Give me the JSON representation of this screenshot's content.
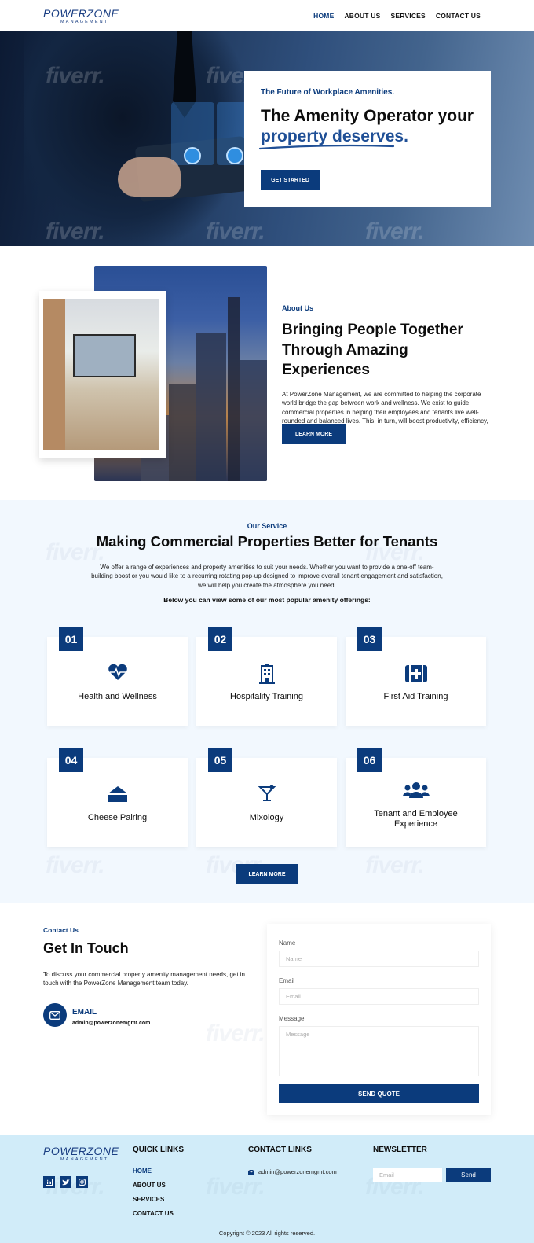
{
  "header": {
    "logo_main": "POWERZONE",
    "logo_sub": "MANAGEMENT",
    "nav": [
      {
        "label": "HOME",
        "active": true
      },
      {
        "label": "ABOUT US",
        "active": false
      },
      {
        "label": "SERVICES",
        "active": false
      },
      {
        "label": "CONTACT US",
        "active": false
      }
    ]
  },
  "hero": {
    "pretitle": "The Future of Workplace Amenities.",
    "title_line1": "The Amenity Operator your",
    "title_line2": "property deserves.",
    "cta": "GET STARTED"
  },
  "about": {
    "pretitle": "About Us",
    "title": "Bringing People Together Through Amazing Experiences",
    "body": "At PowerZone Management, we are committed to helping the corporate world bridge the gap between work and wellness. We exist to guide commercial properties in helping their employees and tenants live well-rounded and balanced lives. This, in turn, will boost productivity, efficiency, and satisfaction.",
    "cta": "LEARN MORE"
  },
  "services": {
    "pretitle": "Our Service",
    "title": "Making Commercial Properties Better for Tenants",
    "body": "We offer a range of experiences and property amenities to suit your needs. Whether you want to provide a one-off team-building boost or you would like to a recurring rotating pop-up designed to improve overall tenant engagement and satisfaction, we will help you create the atmosphere you need.",
    "subheading": "Below you can view some of our most popular amenity offerings:",
    "cards": [
      {
        "num": "01",
        "label": "Health and Wellness",
        "icon": "heartbeat-icon"
      },
      {
        "num": "02",
        "label": "Hospitality Training",
        "icon": "hotel-icon"
      },
      {
        "num": "03",
        "label": "First Aid Training",
        "icon": "first-aid-icon"
      },
      {
        "num": "04",
        "label": "Cheese Pairing",
        "icon": "cheese-icon"
      },
      {
        "num": "05",
        "label": "Mixology",
        "icon": "cocktail-icon"
      },
      {
        "num": "06",
        "label": "Tenant and Employee Experience",
        "icon": "users-icon"
      }
    ],
    "cta": "LEARN MORE"
  },
  "contact": {
    "pretitle": "Contact Us",
    "title": "Get In Touch",
    "body": "To discuss your commercial property amenity management needs, get in touch with the PowerZone Management team today.",
    "email_label": "EMAIL",
    "email_value": "admin@powerzonemgmt.com",
    "form": {
      "name_label": "Name",
      "name_placeholder": "Name",
      "email_label": "Email",
      "email_placeholder": "Email",
      "message_label": "Message",
      "message_placeholder": "Message",
      "submit": "SEND QUOTE"
    }
  },
  "footer": {
    "logo_main": "POWERZONE",
    "logo_sub": "MANAGEMENT",
    "quick_links_title": "QUICK LINKS",
    "quick_links": [
      "HOME",
      "ABOUT US",
      "SERVICES",
      "CONTACT US"
    ],
    "contact_title": "CONTACT LINKS",
    "contact_email": "admin@powerzonemgmt.com",
    "newsletter_title": "NEWSLETTER",
    "newsletter_placeholder": "Email",
    "newsletter_button": "Send",
    "copyright": "Copyright © 2023 All rights reserved.",
    "social": [
      "linkedin-icon",
      "twitter-icon",
      "instagram-icon"
    ]
  },
  "watermark": "fiverr.",
  "colors": {
    "accent": "#0b3b7c",
    "services_bg": "#f2f8fe",
    "footer_bg": "#d1ecf9"
  }
}
